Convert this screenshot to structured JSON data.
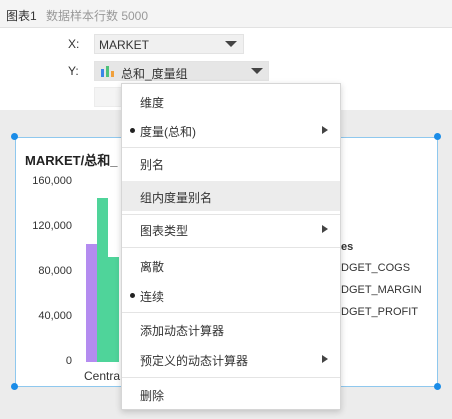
{
  "header": {
    "title": "图表1",
    "sample_rows": "数据样本行数 5000"
  },
  "config": {
    "x_label": "X:",
    "x_value": "MARKET",
    "y_label": "Y:",
    "y_value": "总和_度量组"
  },
  "chart": {
    "title": "MARKET/总和_",
    "yticks": [
      "160,000",
      "120,000",
      "80,000",
      "40,000",
      "0"
    ],
    "x_category": "Centra",
    "legend_title": "es",
    "legend_items": [
      "DGET_COGS",
      "DGET_MARGIN",
      "DGET_PROFIT"
    ],
    "colors": {
      "purple": "#b48cf0",
      "green": "#4fd49a"
    }
  },
  "chart_data": {
    "type": "bar",
    "categories": [
      "Centra"
    ],
    "series": [
      {
        "name": "DGET_COGS",
        "values": [
          105000
        ]
      },
      {
        "name": "DGET_MARGIN",
        "values": [
          146000
        ]
      },
      {
        "name": "DGET_PROFIT",
        "values": [
          93000
        ]
      }
    ],
    "ylim": [
      0,
      160000
    ],
    "title": "MARKET/总和_"
  },
  "menu": {
    "items": [
      {
        "label": "维度",
        "bullet": false,
        "submenu": false
      },
      {
        "label": "度量(总和)",
        "bullet": true,
        "submenu": true
      },
      {
        "label": "别名",
        "bullet": false,
        "submenu": false
      },
      {
        "label": "组内度量别名",
        "bullet": false,
        "submenu": false,
        "highlighted": true
      },
      {
        "label": "图表类型",
        "bullet": false,
        "submenu": true
      },
      {
        "label": "离散",
        "bullet": false,
        "submenu": false
      },
      {
        "label": "连续",
        "bullet": true,
        "submenu": false
      },
      {
        "label": "添加动态计算器",
        "bullet": false,
        "submenu": false
      },
      {
        "label": "预定义的动态计算器",
        "bullet": false,
        "submenu": true
      },
      {
        "label": "删除",
        "bullet": false,
        "submenu": false
      }
    ]
  }
}
